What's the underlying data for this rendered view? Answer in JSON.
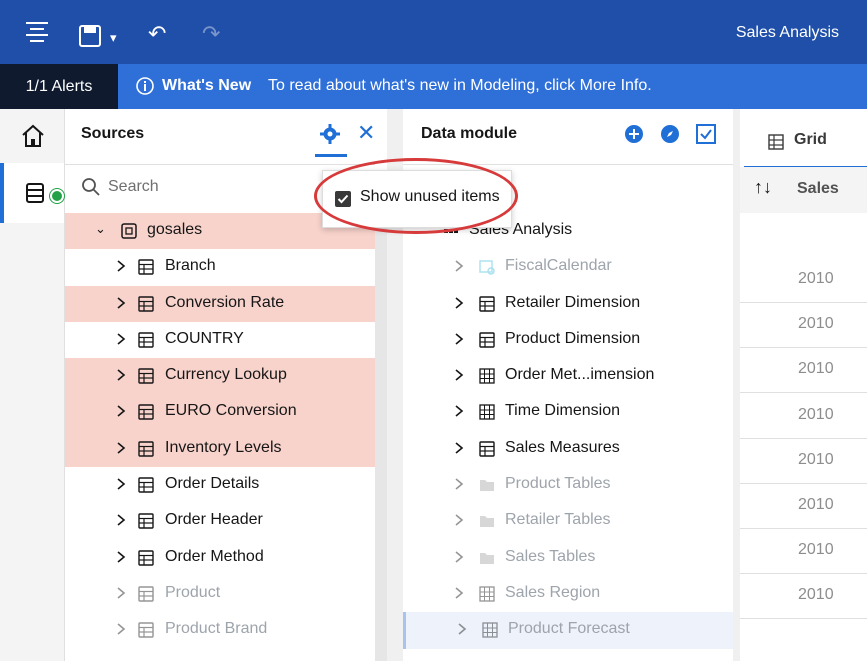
{
  "header": {
    "title": "Sales Analysis"
  },
  "alerts": {
    "count": "1/1 Alerts",
    "title": "What's New",
    "message": "To read about what's new in Modeling, click More Info."
  },
  "sources": {
    "title": "Sources",
    "search_placeholder": "Search",
    "root": "gosales",
    "items": [
      {
        "label": "Branch",
        "highlight": false,
        "dim": false
      },
      {
        "label": "Conversion Rate",
        "highlight": true,
        "dim": false
      },
      {
        "label": "COUNTRY",
        "highlight": false,
        "dim": false
      },
      {
        "label": "Currency Lookup",
        "highlight": true,
        "dim": false
      },
      {
        "label": "EURO Conversion",
        "highlight": true,
        "dim": false
      },
      {
        "label": "Inventory Levels",
        "highlight": true,
        "dim": false
      },
      {
        "label": "Order Details",
        "highlight": false,
        "dim": false
      },
      {
        "label": "Order Header",
        "highlight": false,
        "dim": false
      },
      {
        "label": "Order Method",
        "highlight": false,
        "dim": false
      },
      {
        "label": "Product",
        "highlight": false,
        "dim": true
      },
      {
        "label": "Product Brand",
        "highlight": false,
        "dim": true
      }
    ]
  },
  "data_module": {
    "title": "Data module",
    "root": "Sales Analysis",
    "items": [
      {
        "label": "FiscalCalendar",
        "icon": "calendar",
        "dim": true
      },
      {
        "label": "Retailer Dimension",
        "icon": "table",
        "dim": false
      },
      {
        "label": "Product Dimension",
        "icon": "table",
        "dim": false
      },
      {
        "label": "Order Met...imension",
        "icon": "grid",
        "dim": false
      },
      {
        "label": "Time Dimension",
        "icon": "grid",
        "dim": false
      },
      {
        "label": "Sales Measures",
        "icon": "table",
        "dim": false
      },
      {
        "label": "Product Tables",
        "icon": "folder",
        "dim": true
      },
      {
        "label": "Retailer Tables",
        "icon": "folder",
        "dim": true
      },
      {
        "label": "Sales Tables",
        "icon": "folder",
        "dim": true
      },
      {
        "label": "Sales Region",
        "icon": "grid",
        "dim": true
      },
      {
        "label": "Product Forecast",
        "icon": "grid",
        "dim": true
      }
    ]
  },
  "popup": {
    "label": "Show unused items",
    "checked": true
  },
  "grid": {
    "tab": "Grid",
    "column": "Sales",
    "values": [
      "2010",
      "2010",
      "2010",
      "2010",
      "2010",
      "2010",
      "2010",
      "2010"
    ]
  }
}
